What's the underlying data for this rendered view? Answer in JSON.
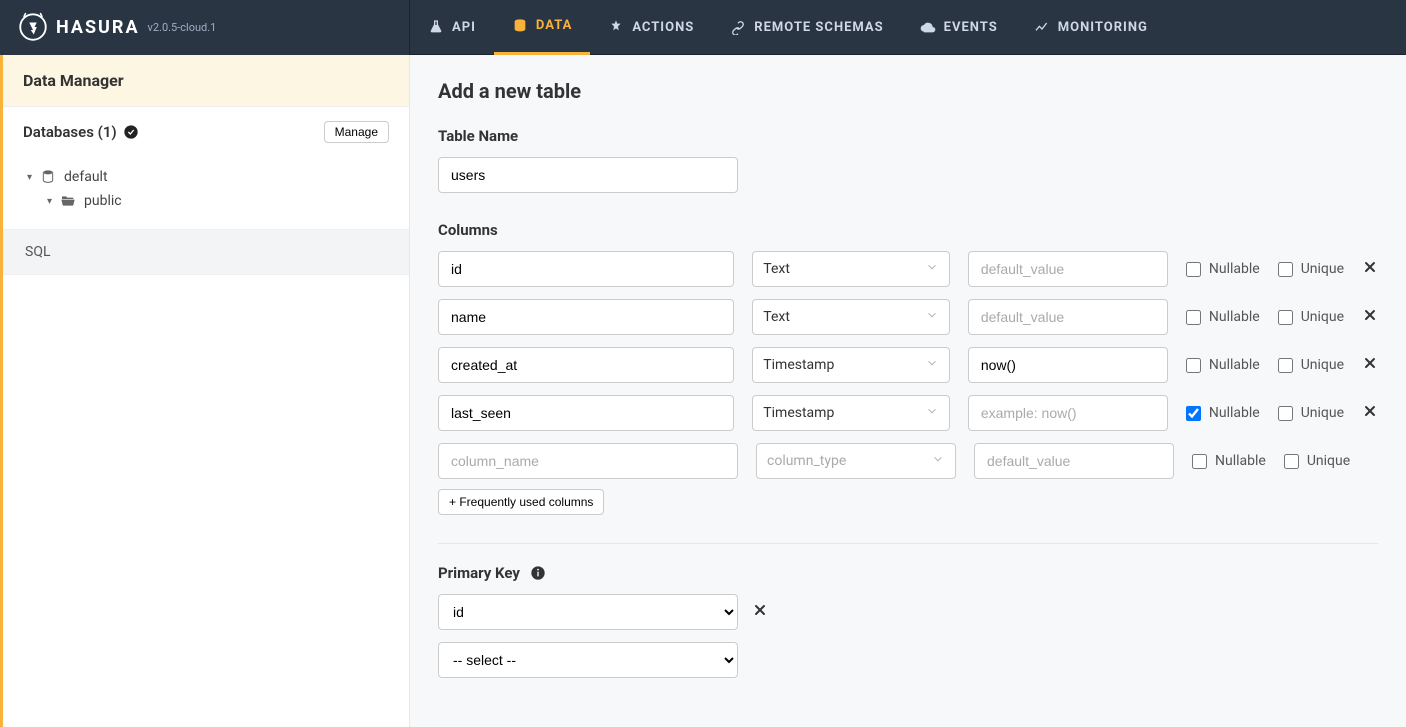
{
  "brand": {
    "name": "HASURA",
    "version": "v2.0.5-cloud.1"
  },
  "nav": {
    "api": "API",
    "data": "DATA",
    "actions": "ACTIONS",
    "remote_schemas": "REMOTE SCHEMAS",
    "events": "EVENTS",
    "monitoring": "MONITORING"
  },
  "sidebar": {
    "title": "Data Manager",
    "databases_label": "Databases (1)",
    "manage": "Manage",
    "tree": {
      "db": "default",
      "schema": "public"
    },
    "sql": "SQL"
  },
  "page": {
    "title": "Add a new table",
    "table_name_label": "Table Name",
    "table_name_value": "users",
    "columns_label": "Columns",
    "nullable_label": "Nullable",
    "unique_label": "Unique",
    "default_placeholder": "default_value",
    "colname_placeholder": "column_name",
    "coltype_placeholder": "column_type",
    "freq_btn": "+ Frequently used columns",
    "pk_label": "Primary Key",
    "columns": [
      {
        "name": "id",
        "type": "Text",
        "default": "",
        "default_ph": "default_value",
        "nullable": false,
        "unique": false,
        "has_delete": true
      },
      {
        "name": "name",
        "type": "Text",
        "default": "",
        "default_ph": "default_value",
        "nullable": false,
        "unique": false,
        "has_delete": true
      },
      {
        "name": "created_at",
        "type": "Timestamp",
        "default": "now()",
        "default_ph": "default_value",
        "nullable": false,
        "unique": false,
        "has_delete": true
      },
      {
        "name": "last_seen",
        "type": "Timestamp",
        "default": "",
        "default_ph": "example: now()",
        "nullable": true,
        "unique": false,
        "has_delete": true
      },
      {
        "name": "",
        "type": "",
        "default": "",
        "default_ph": "default_value",
        "nullable": false,
        "unique": false,
        "has_delete": false
      }
    ],
    "pk_rows": [
      {
        "value": "id",
        "has_delete": true
      },
      {
        "value": "-- select --",
        "has_delete": false
      }
    ]
  }
}
